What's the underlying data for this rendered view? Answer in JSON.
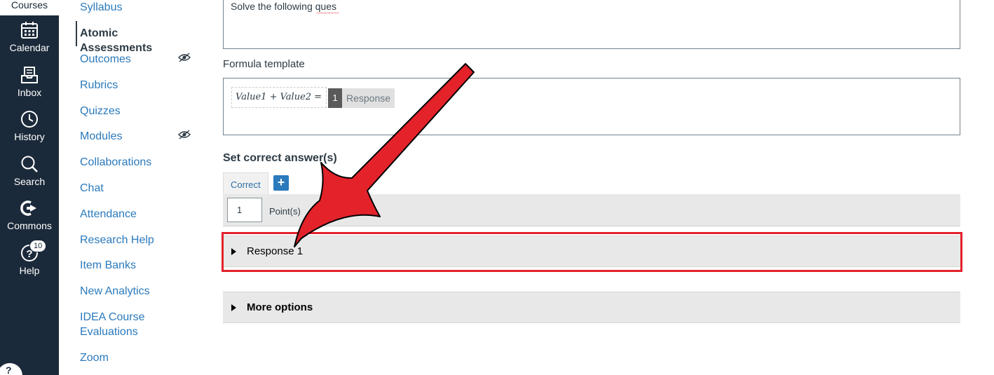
{
  "global_nav": {
    "courses_label": "Courses",
    "items": [
      {
        "label": "Calendar",
        "icon": "calendar-icon"
      },
      {
        "label": "Inbox",
        "icon": "inbox-icon"
      },
      {
        "label": "History",
        "icon": "clock-icon"
      },
      {
        "label": "Search",
        "icon": "search-icon"
      },
      {
        "label": "Commons",
        "icon": "commons-icon"
      },
      {
        "label": "Help",
        "icon": "help-icon",
        "badge": "10"
      }
    ]
  },
  "course_nav": {
    "items": [
      {
        "label": "Syllabus"
      },
      {
        "label": "Atomic Assessments",
        "active": true
      },
      {
        "label": "Outcomes",
        "hidden_icon": true
      },
      {
        "label": "Rubrics"
      },
      {
        "label": "Quizzes"
      },
      {
        "label": "Modules",
        "hidden_icon": true
      },
      {
        "label": "Collaborations"
      },
      {
        "label": "Chat"
      },
      {
        "label": "Attendance"
      },
      {
        "label": "Research Help"
      },
      {
        "label": "Item Banks"
      },
      {
        "label": "New Analytics"
      },
      {
        "label": "IDEA Course Evaluations"
      },
      {
        "label": "Zoom"
      }
    ]
  },
  "editor": {
    "question_text": "Solve the following ques",
    "formula_template_label": "Formula template",
    "formula_expression": "Value1 + Value2  =",
    "response_number": "1",
    "response_label": "Response",
    "set_correct_label": "Set correct answer(s)",
    "correct_tab": "Correct",
    "add_label": "+",
    "points_value": "1",
    "points_label": "Point(s)",
    "response_accordion": "Response 1",
    "more_options": "More options"
  },
  "colors": {
    "global_nav_bg": "#1b2a3a",
    "link": "#2b7abc",
    "highlight": "#e3222a",
    "arrow": "#e3222a"
  }
}
